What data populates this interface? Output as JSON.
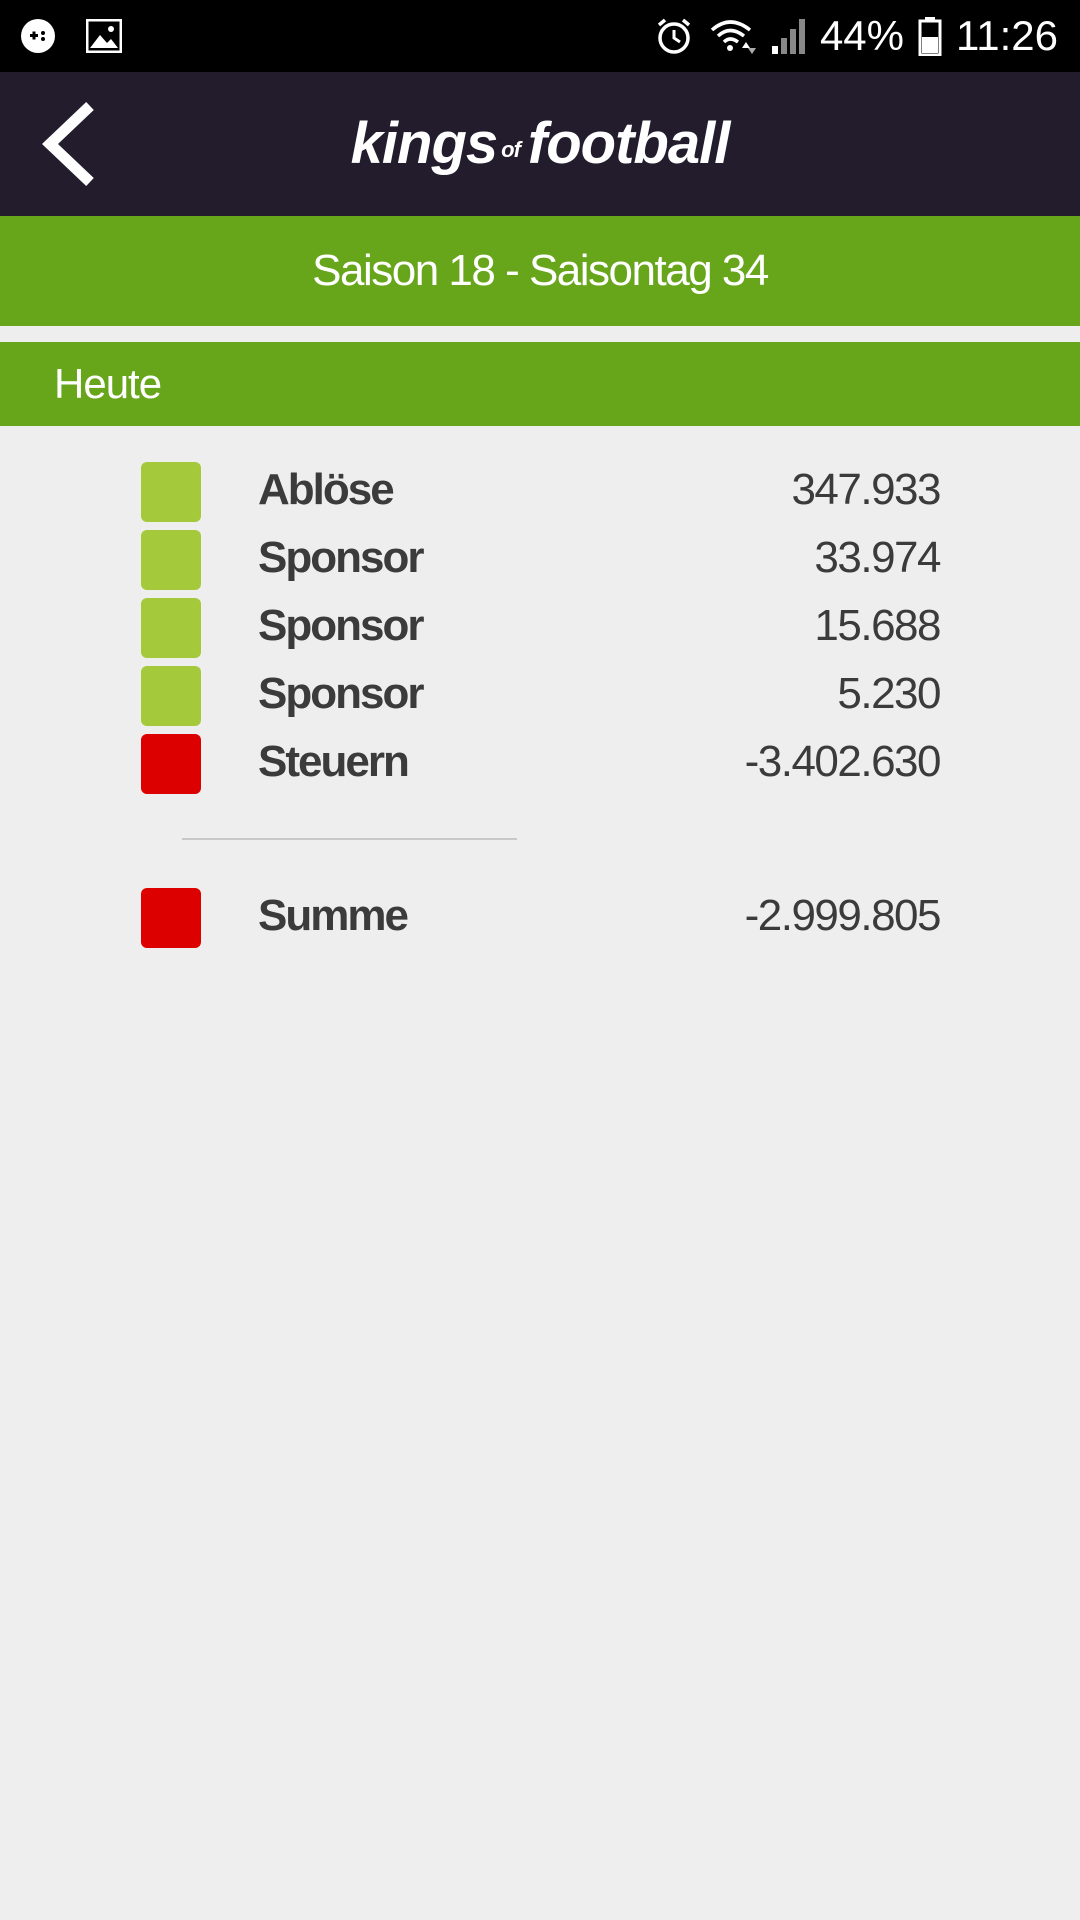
{
  "status_bar": {
    "left_icons": [
      "game-controller-icon",
      "image-icon"
    ],
    "battery_percent": "44%",
    "time": "11:26"
  },
  "header": {
    "logo_part1": "kings",
    "logo_part2": "of",
    "logo_part3": "football"
  },
  "season_bar": {
    "title": "Saison 18 - Saisontag 34"
  },
  "section": {
    "title": "Heute"
  },
  "colors": {
    "positive": "#a4c93a",
    "negative": "#dd0000",
    "header_bg": "#221c2c",
    "accent_green": "#67a61b"
  },
  "items": [
    {
      "label": "Ablöse",
      "value": "347.933",
      "status": "positive"
    },
    {
      "label": "Sponsor",
      "value": "33.974",
      "status": "positive"
    },
    {
      "label": "Sponsor",
      "value": "15.688",
      "status": "positive"
    },
    {
      "label": "Sponsor",
      "value": "5.230",
      "status": "positive"
    },
    {
      "label": "Steuern",
      "value": "-3.402.630",
      "status": "negative"
    }
  ],
  "sum": {
    "label": "Summe",
    "value": "-2.999.805",
    "status": "negative"
  }
}
